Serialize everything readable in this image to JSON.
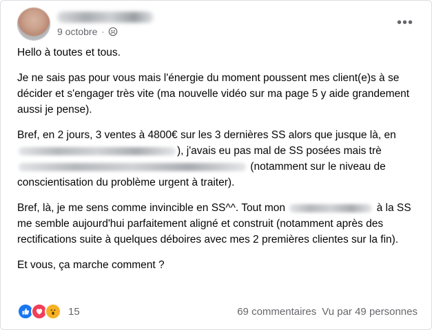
{
  "post": {
    "date": "9 octobre",
    "separator": "·",
    "paragraphs": {
      "p1": "Hello à toutes et tous.",
      "p2": "Je ne sais pas pour vous mais l'énergie du moment poussent mes client(e)s à se décider et s'engager très vite (ma nouvelle vidéo sur ma page 5 y aide grandement aussi je pense).",
      "p3_a": "Bref, en 2 jours, 3 ventes à 4800€ sur les 3 dernières SS alors que jusque là, en ",
      "p3_b": "), j'avais eu pas mal de SS posées mais trè",
      "p3_c": " (notamment sur le niveau de conscientisation du problème urgent à traiter).",
      "p4_a": "Bref, là, je me sens comme invincible en SS^^. Tout mon ",
      "p4_b": " à la SS me semble aujourd'hui parfaitement aligné et construit (notamment après des rectifications suite à quelques déboires avec mes 2 premières clientes sur la fin).",
      "p5": "Et vous, ça marche comment ?"
    }
  },
  "footer": {
    "reaction_count": "15",
    "comments": "69 commentaires",
    "views": "Vu par 49 personnes"
  },
  "icons": {
    "more": "more-options-icon",
    "privacy": "friends-privacy-icon",
    "reactions": [
      "like-icon",
      "love-icon",
      "wow-icon"
    ]
  },
  "colors": {
    "like": "#1877f2",
    "love": "#f33e58",
    "wow": "#f7b125",
    "secondary_text": "#65676b"
  }
}
